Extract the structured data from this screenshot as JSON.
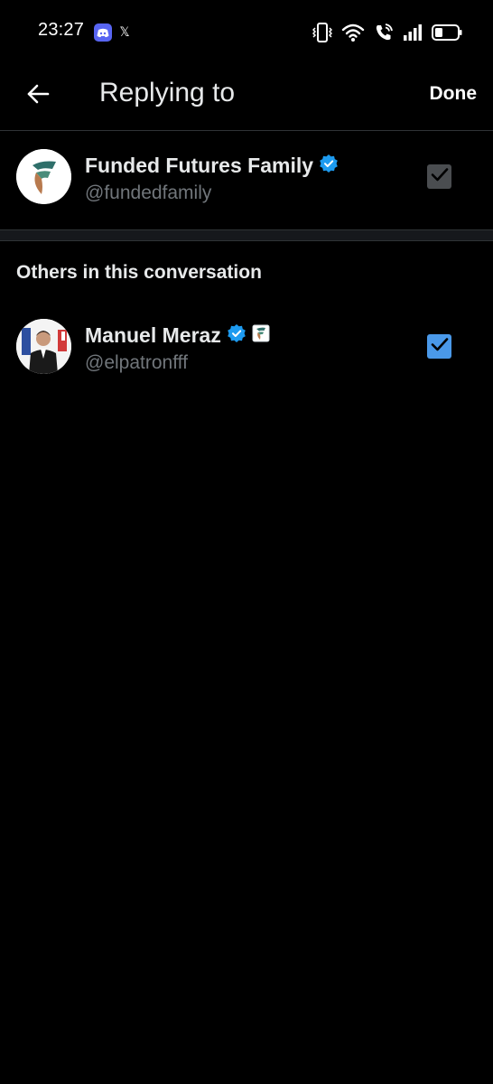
{
  "status_bar": {
    "time": "23:27",
    "apps": [
      {
        "name": "discord-icon",
        "color": "#5865f2"
      },
      {
        "name": "x-icon",
        "glyph": "𝕏"
      }
    ],
    "indicators": [
      "vibrate-icon",
      "wifi-icon",
      "wifi-calling-icon",
      "signal-icon",
      "battery-icon"
    ],
    "battery_level": 0.35
  },
  "header": {
    "back_icon": "arrow-left-icon",
    "title": "Replying to",
    "done_label": "Done"
  },
  "primary_account": {
    "name": "Funded Futures Family",
    "handle": "@fundedfamily",
    "verified": true,
    "checked": true,
    "checkbox_state": "disabled"
  },
  "others_section": {
    "heading": "Others in this conversation",
    "accounts": [
      {
        "name": "Manuel Meraz",
        "handle": "@elpatronfff",
        "verified": true,
        "affiliate_badge": true,
        "checked": true,
        "checkbox_state": "enabled"
      }
    ]
  },
  "colors": {
    "background": "#000000",
    "verified_blue": "#1d9bf0",
    "checkbox_blue": "#4a99e9",
    "muted_text": "#71767b",
    "brand_teal": "#2f6f6a"
  }
}
